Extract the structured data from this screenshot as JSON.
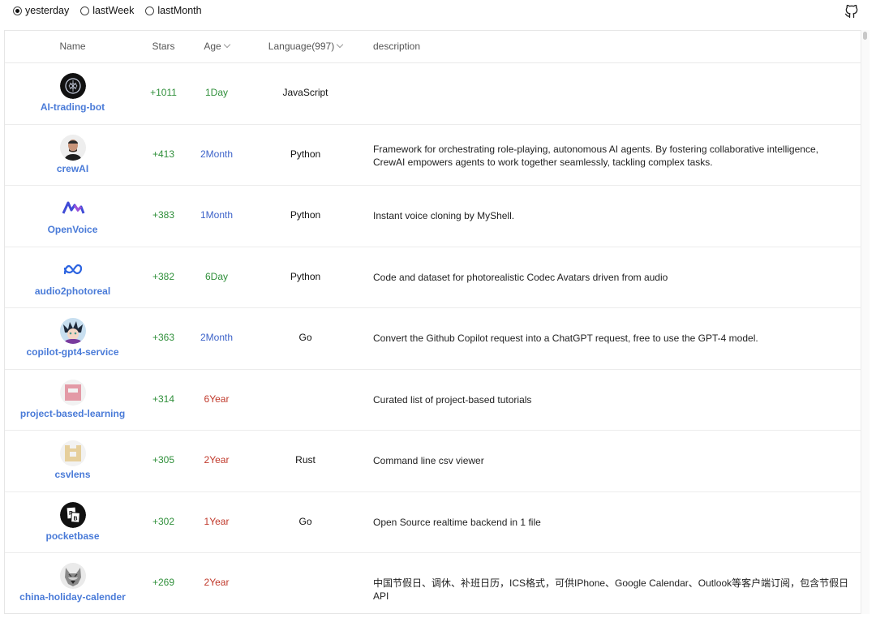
{
  "filters": {
    "options": [
      {
        "label": "yesterday",
        "checked": true
      },
      {
        "label": "lastWeek",
        "checked": false
      },
      {
        "label": "lastMonth",
        "checked": false
      }
    ],
    "github_icon": "github-icon"
  },
  "table": {
    "headers": {
      "name": "Name",
      "stars": "Stars",
      "age": "Age",
      "language": "Language(997)",
      "description": "description"
    },
    "rows": [
      {
        "name": "AI-trading-bot",
        "stars": "+1011",
        "age": "1Day",
        "age_unit": "day",
        "language": "JavaScript",
        "description": "",
        "avatar_icon": "ai-bot-avatar"
      },
      {
        "name": "crewAI",
        "stars": "+413",
        "age": "2Month",
        "age_unit": "month",
        "language": "Python",
        "description": "Framework for orchestrating role-playing, autonomous AI agents. By fostering collaborative intelligence, CrewAI empowers agents to work together seamlessly, tackling complex tasks.",
        "avatar_icon": "person-avatar"
      },
      {
        "name": "OpenVoice",
        "stars": "+383",
        "age": "1Month",
        "age_unit": "month",
        "language": "Python",
        "description": "Instant voice cloning by MyShell.",
        "avatar_icon": "myshell-logo"
      },
      {
        "name": "audio2photoreal",
        "stars": "+382",
        "age": "6Day",
        "age_unit": "day",
        "language": "Python",
        "description": "Code and dataset for photorealistic Codec Avatars driven from audio",
        "avatar_icon": "meta-logo"
      },
      {
        "name": "copilot-gpt4-service",
        "stars": "+363",
        "age": "2Month",
        "age_unit": "month",
        "language": "Go",
        "description": "Convert the Github Copilot request into a ChatGPT request, free to use the GPT-4 model.",
        "avatar_icon": "anime-avatar"
      },
      {
        "name": "project-based-learning",
        "stars": "+314",
        "age": "6Year",
        "age_unit": "year",
        "language": "",
        "description": "Curated list of project-based tutorials",
        "avatar_icon": "identicon-pink"
      },
      {
        "name": "csvlens",
        "stars": "+305",
        "age": "2Year",
        "age_unit": "year",
        "language": "Rust",
        "description": "Command line csv viewer",
        "avatar_icon": "identicon-tan"
      },
      {
        "name": "pocketbase",
        "stars": "+302",
        "age": "1Year",
        "age_unit": "year",
        "language": "Go",
        "description": "Open Source realtime backend in 1 file",
        "avatar_icon": "pocketbase-logo"
      },
      {
        "name": "china-holiday-calender",
        "stars": "+269",
        "age": "2Year",
        "age_unit": "year",
        "language": "",
        "description": "中国节假日、调休、补班日历，ICS格式，可供IPhone、Google Calendar、Outlook等客户端订阅，包含节假日API",
        "avatar_icon": "wolf-avatar"
      }
    ]
  },
  "colors": {
    "link": "#4a7bd8",
    "stars_green": "#2f8f3a",
    "age_day": "#2f8f3a",
    "age_month": "#3d63c9",
    "age_year": "#c0392b"
  }
}
